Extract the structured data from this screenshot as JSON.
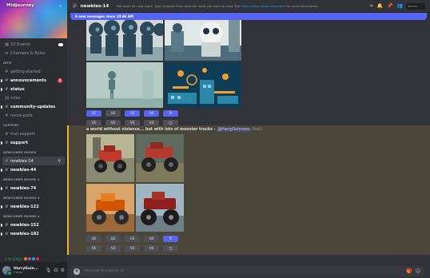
{
  "server": {
    "name": "Midjourney"
  },
  "sidebar": {
    "top_items": [
      {
        "label": "10 Events",
        "icon": "calendar-icon"
      },
      {
        "label": "Channels & Roles",
        "icon": "list-icon"
      }
    ],
    "categories": [
      {
        "name": "INFO",
        "channels": [
          {
            "label": "getting-started",
            "bright": false
          },
          {
            "label": "announcements",
            "bright": true,
            "badge": "1"
          },
          {
            "label": "status",
            "bright": true
          },
          {
            "label": "rules",
            "bright": false
          },
          {
            "label": "community-updates",
            "bright": true
          },
          {
            "label": "micro-polls",
            "bright": false
          }
        ]
      },
      {
        "name": "SUPPORT",
        "channels": [
          {
            "label": "trial-support",
            "bright": false
          },
          {
            "label": "support",
            "bright": true
          }
        ]
      },
      {
        "name": "NEWCOMER ROOMS",
        "channels": [
          {
            "label": "newbies-14",
            "bright": true,
            "selected": true
          },
          {
            "label": "newbies-44",
            "bright": true
          }
        ]
      },
      {
        "name": "NEWCOMER ROOMS 2",
        "channels": [
          {
            "label": "newbies-74",
            "bright": true
          }
        ]
      },
      {
        "name": "NEWCOMER ROOMS 3",
        "channels": [
          {
            "label": "newbies-122",
            "bright": true
          }
        ]
      },
      {
        "name": "NEWCOMER ROOMS 4",
        "channels": [
          {
            "label": "newbies-152",
            "bright": true
          },
          {
            "label": "newbies-182",
            "bright": true
          }
        ]
      }
    ],
    "voice": {
      "label": "4 IN VOICE"
    }
  },
  "user": {
    "name": "HarryGuin...",
    "status": "Online"
  },
  "header": {
    "channel": "newbies-14",
    "topic_prefix": "Bot room for new users. Type /imagine then describe what you want to draw. See ",
    "topic_link": "https://docs.midjourney.com/",
    "topic_suffix": " for more information.",
    "search_placeholder": "Search"
  },
  "banner": {
    "new_messages": "6 new messages since 10:46 AM"
  },
  "messages": [
    {
      "upscale_buttons": [
        "U1",
        "U2",
        "U3",
        "U4"
      ],
      "active_upscales": [
        0,
        2,
        3
      ],
      "variation_buttons": [
        "V1",
        "V2",
        "V3",
        "V4"
      ]
    },
    {
      "prompt": "a world without violence... but with lots of monster trucks",
      "separator": " - ",
      "mention": "@HarryGuinness",
      "mode": "(fast)",
      "upscale_buttons": [
        "U1",
        "U2",
        "U3",
        "U4"
      ],
      "variation_buttons": [
        "V1",
        "V2",
        "V3",
        "V4"
      ]
    }
  ],
  "composer": {
    "placeholder": "Message #newbies-14"
  },
  "colors": {
    "accent": "#5865f2",
    "highlight": "#4a4639",
    "highlight_bar": "#f0b232",
    "mention_red": "#f23f43",
    "online": "#23a55a"
  }
}
